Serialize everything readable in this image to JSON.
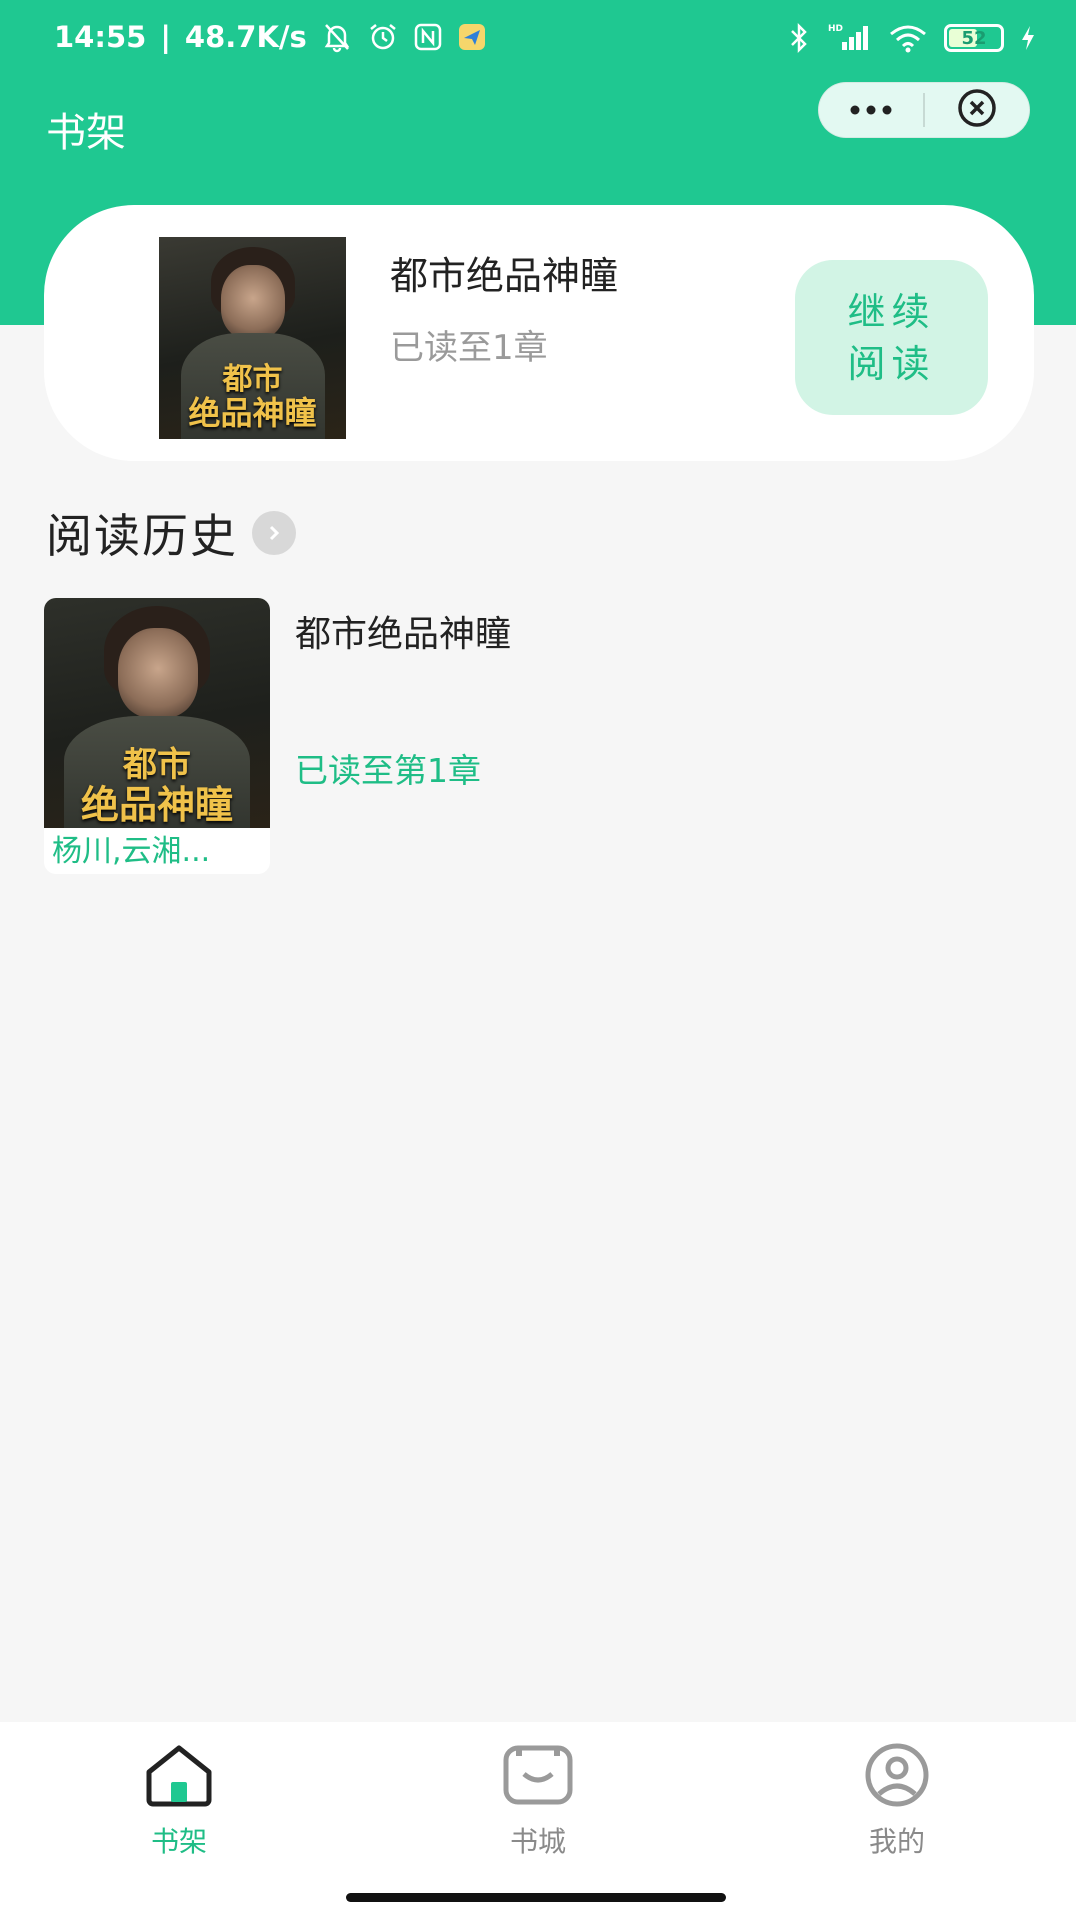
{
  "status_bar": {
    "time": "14:55",
    "separator": "|",
    "speed": "48.7K/s",
    "battery": "52",
    "icons": [
      "bell-muted-icon",
      "alarm-icon",
      "nfc-icon",
      "app-notification-icon",
      "bluetooth-icon",
      "hd-signal-icon",
      "wifi-icon",
      "battery-icon",
      "charging-icon"
    ]
  },
  "nav": {
    "title": "书架",
    "more_icon": "more-dots-icon",
    "close_icon": "close-circle-icon"
  },
  "current_book": {
    "title": "都市绝品神瞳",
    "progress": "已读至1章",
    "continue_line1": "继续",
    "continue_line2": "阅读",
    "cover_text_line1": "都市",
    "cover_text_line2": "绝品神瞳"
  },
  "history": {
    "section_title": "阅读历史",
    "items": [
      {
        "title": "都市绝品神瞳",
        "progress": "已读至第1章",
        "author": "杨川,云湘...",
        "cover_text_line1": "都市",
        "cover_text_line2": "绝品神瞳"
      }
    ]
  },
  "tabs": [
    {
      "label": "书架",
      "icon": "home-icon",
      "active": true
    },
    {
      "label": "书城",
      "icon": "store-icon",
      "active": false
    },
    {
      "label": "我的",
      "icon": "profile-icon",
      "active": false
    }
  ],
  "colors": {
    "brand": "#1fc891",
    "accent_text": "#1fbd86",
    "button_bg": "#d2f4e5",
    "page_bg": "#f6f6f6"
  }
}
